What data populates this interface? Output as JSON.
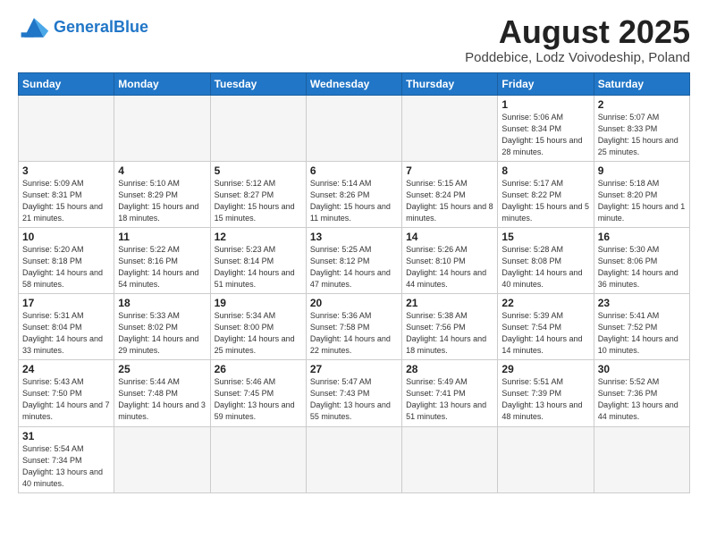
{
  "logo": {
    "general": "General",
    "blue": "Blue"
  },
  "title": "August 2025",
  "subtitle": "Poddebice, Lodz Voivodeship, Poland",
  "days_of_week": [
    "Sunday",
    "Monday",
    "Tuesday",
    "Wednesday",
    "Thursday",
    "Friday",
    "Saturday"
  ],
  "weeks": [
    [
      {
        "day": "",
        "info": "",
        "empty": true
      },
      {
        "day": "",
        "info": "",
        "empty": true
      },
      {
        "day": "",
        "info": "",
        "empty": true
      },
      {
        "day": "",
        "info": "",
        "empty": true
      },
      {
        "day": "",
        "info": "",
        "empty": true
      },
      {
        "day": "1",
        "info": "Sunrise: 5:06 AM\nSunset: 8:34 PM\nDaylight: 15 hours\nand 28 minutes.",
        "empty": false
      },
      {
        "day": "2",
        "info": "Sunrise: 5:07 AM\nSunset: 8:33 PM\nDaylight: 15 hours\nand 25 minutes.",
        "empty": false
      }
    ],
    [
      {
        "day": "3",
        "info": "Sunrise: 5:09 AM\nSunset: 8:31 PM\nDaylight: 15 hours\nand 21 minutes.",
        "empty": false
      },
      {
        "day": "4",
        "info": "Sunrise: 5:10 AM\nSunset: 8:29 PM\nDaylight: 15 hours\nand 18 minutes.",
        "empty": false
      },
      {
        "day": "5",
        "info": "Sunrise: 5:12 AM\nSunset: 8:27 PM\nDaylight: 15 hours\nand 15 minutes.",
        "empty": false
      },
      {
        "day": "6",
        "info": "Sunrise: 5:14 AM\nSunset: 8:26 PM\nDaylight: 15 hours\nand 11 minutes.",
        "empty": false
      },
      {
        "day": "7",
        "info": "Sunrise: 5:15 AM\nSunset: 8:24 PM\nDaylight: 15 hours\nand 8 minutes.",
        "empty": false
      },
      {
        "day": "8",
        "info": "Sunrise: 5:17 AM\nSunset: 8:22 PM\nDaylight: 15 hours\nand 5 minutes.",
        "empty": false
      },
      {
        "day": "9",
        "info": "Sunrise: 5:18 AM\nSunset: 8:20 PM\nDaylight: 15 hours\nand 1 minute.",
        "empty": false
      }
    ],
    [
      {
        "day": "10",
        "info": "Sunrise: 5:20 AM\nSunset: 8:18 PM\nDaylight: 14 hours\nand 58 minutes.",
        "empty": false
      },
      {
        "day": "11",
        "info": "Sunrise: 5:22 AM\nSunset: 8:16 PM\nDaylight: 14 hours\nand 54 minutes.",
        "empty": false
      },
      {
        "day": "12",
        "info": "Sunrise: 5:23 AM\nSunset: 8:14 PM\nDaylight: 14 hours\nand 51 minutes.",
        "empty": false
      },
      {
        "day": "13",
        "info": "Sunrise: 5:25 AM\nSunset: 8:12 PM\nDaylight: 14 hours\nand 47 minutes.",
        "empty": false
      },
      {
        "day": "14",
        "info": "Sunrise: 5:26 AM\nSunset: 8:10 PM\nDaylight: 14 hours\nand 44 minutes.",
        "empty": false
      },
      {
        "day": "15",
        "info": "Sunrise: 5:28 AM\nSunset: 8:08 PM\nDaylight: 14 hours\nand 40 minutes.",
        "empty": false
      },
      {
        "day": "16",
        "info": "Sunrise: 5:30 AM\nSunset: 8:06 PM\nDaylight: 14 hours\nand 36 minutes.",
        "empty": false
      }
    ],
    [
      {
        "day": "17",
        "info": "Sunrise: 5:31 AM\nSunset: 8:04 PM\nDaylight: 14 hours\nand 33 minutes.",
        "empty": false
      },
      {
        "day": "18",
        "info": "Sunrise: 5:33 AM\nSunset: 8:02 PM\nDaylight: 14 hours\nand 29 minutes.",
        "empty": false
      },
      {
        "day": "19",
        "info": "Sunrise: 5:34 AM\nSunset: 8:00 PM\nDaylight: 14 hours\nand 25 minutes.",
        "empty": false
      },
      {
        "day": "20",
        "info": "Sunrise: 5:36 AM\nSunset: 7:58 PM\nDaylight: 14 hours\nand 22 minutes.",
        "empty": false
      },
      {
        "day": "21",
        "info": "Sunrise: 5:38 AM\nSunset: 7:56 PM\nDaylight: 14 hours\nand 18 minutes.",
        "empty": false
      },
      {
        "day": "22",
        "info": "Sunrise: 5:39 AM\nSunset: 7:54 PM\nDaylight: 14 hours\nand 14 minutes.",
        "empty": false
      },
      {
        "day": "23",
        "info": "Sunrise: 5:41 AM\nSunset: 7:52 PM\nDaylight: 14 hours\nand 10 minutes.",
        "empty": false
      }
    ],
    [
      {
        "day": "24",
        "info": "Sunrise: 5:43 AM\nSunset: 7:50 PM\nDaylight: 14 hours\nand 7 minutes.",
        "empty": false
      },
      {
        "day": "25",
        "info": "Sunrise: 5:44 AM\nSunset: 7:48 PM\nDaylight: 14 hours\nand 3 minutes.",
        "empty": false
      },
      {
        "day": "26",
        "info": "Sunrise: 5:46 AM\nSunset: 7:45 PM\nDaylight: 13 hours\nand 59 minutes.",
        "empty": false
      },
      {
        "day": "27",
        "info": "Sunrise: 5:47 AM\nSunset: 7:43 PM\nDaylight: 13 hours\nand 55 minutes.",
        "empty": false
      },
      {
        "day": "28",
        "info": "Sunrise: 5:49 AM\nSunset: 7:41 PM\nDaylight: 13 hours\nand 51 minutes.",
        "empty": false
      },
      {
        "day": "29",
        "info": "Sunrise: 5:51 AM\nSunset: 7:39 PM\nDaylight: 13 hours\nand 48 minutes.",
        "empty": false
      },
      {
        "day": "30",
        "info": "Sunrise: 5:52 AM\nSunset: 7:36 PM\nDaylight: 13 hours\nand 44 minutes.",
        "empty": false
      }
    ],
    [
      {
        "day": "31",
        "info": "Sunrise: 5:54 AM\nSunset: 7:34 PM\nDaylight: 13 hours\nand 40 minutes.",
        "empty": false
      },
      {
        "day": "",
        "info": "",
        "empty": true
      },
      {
        "day": "",
        "info": "",
        "empty": true
      },
      {
        "day": "",
        "info": "",
        "empty": true
      },
      {
        "day": "",
        "info": "",
        "empty": true
      },
      {
        "day": "",
        "info": "",
        "empty": true
      },
      {
        "day": "",
        "info": "",
        "empty": true
      }
    ]
  ]
}
